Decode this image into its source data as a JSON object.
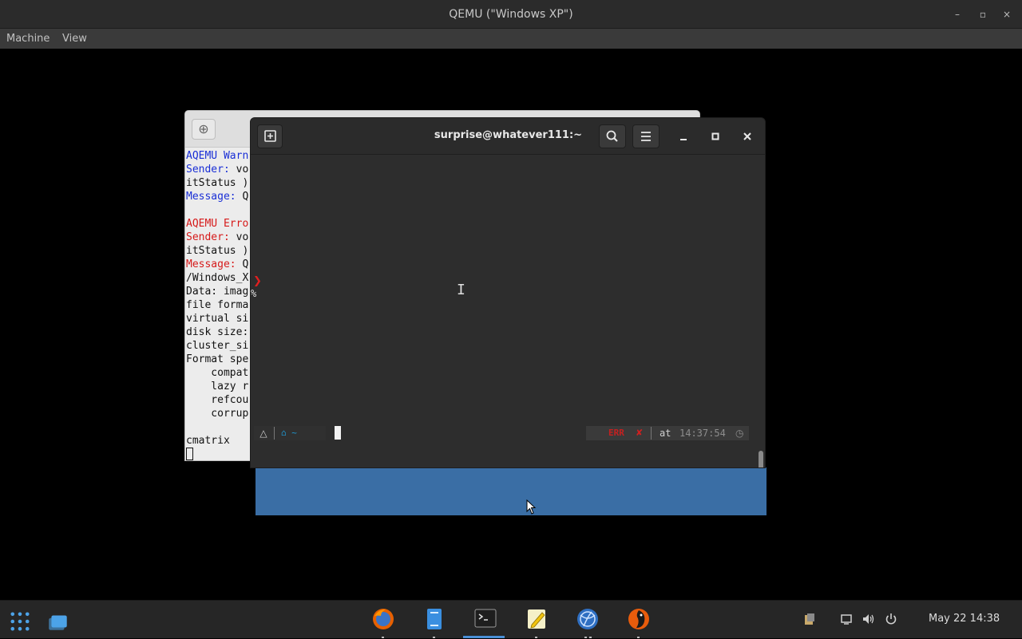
{
  "qemu": {
    "title": "QEMU (\"Windows XP\")",
    "menu": [
      "Machine",
      "View"
    ],
    "minimize": "–",
    "maximize": "▫",
    "close": "×"
  },
  "back_terminal": {
    "new_tab": "⊕",
    "lines": [
      {
        "text": "AQEMU Warn",
        "cls": "blue"
      },
      {
        "text": "Sender: ",
        "cls": "blue",
        "rest": "vo"
      },
      {
        "text": "itStatus )",
        "cls": ""
      },
      {
        "text": "Message: ",
        "cls": "blue",
        "rest": "Q"
      },
      {
        "text": "",
        "cls": ""
      },
      {
        "text": "AQEMU Erro",
        "cls": "red"
      },
      {
        "text": "Sender: ",
        "cls": "red",
        "rest": "vo"
      },
      {
        "text": "itStatus )",
        "cls": ""
      },
      {
        "text": "Message: ",
        "cls": "red",
        "rest": "Q"
      },
      {
        "text": "/Windows_X",
        "cls": ""
      },
      {
        "text": "Data: imag",
        "cls": ""
      },
      {
        "text": "file forma",
        "cls": ""
      },
      {
        "text": "virtual si",
        "cls": ""
      },
      {
        "text": "disk size:",
        "cls": ""
      },
      {
        "text": "cluster_si",
        "cls": ""
      },
      {
        "text": "Format spe",
        "cls": ""
      },
      {
        "text": "    compat",
        "cls": ""
      },
      {
        "text": "    lazy r",
        "cls": ""
      },
      {
        "text": "    refcou",
        "cls": ""
      },
      {
        "text": "    corrup",
        "cls": ""
      },
      {
        "text": "",
        "cls": ""
      },
      {
        "text": "cmatrix",
        "cls": ""
      }
    ]
  },
  "front_terminal": {
    "title": "surprise@whatever111:~",
    "prompt_dir": "⌂ ~",
    "status_err": "ERR",
    "status_x": "✘",
    "status_at": "at",
    "status_time": "14:37:54",
    "chevron": "❯",
    "pct": "%"
  },
  "taskbar": {
    "date": "May 22  14:38",
    "apps": [
      "firefox",
      "files",
      "terminal",
      "text-editor",
      "network",
      "qemu-bird"
    ]
  },
  "colors": {
    "xp_blue": "#3a6ea5",
    "terminal_bg": "#2d2d2d",
    "taskbar_bg": "#262626"
  }
}
